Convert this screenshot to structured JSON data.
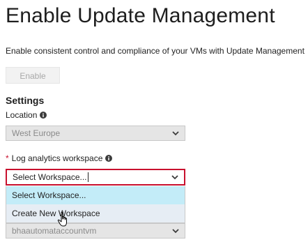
{
  "page": {
    "title": "Enable Update Management",
    "subtitle": "Enable consistent control and compliance of your VMs with Update Management"
  },
  "actions": {
    "enable_label": "Enable"
  },
  "settings": {
    "heading": "Settings",
    "location": {
      "label": "Location",
      "value": "West Europe",
      "icon": "info-icon"
    },
    "workspace": {
      "required_marker": "*",
      "label": "Log analytics workspace",
      "value": "Select Workspace...",
      "icon": "info-icon",
      "options": [
        {
          "label": "Select Workspace...",
          "state": "selected"
        },
        {
          "label": "Create New Workspace",
          "state": "hover"
        }
      ]
    },
    "automation_account": {
      "value": "bhaautomataccountvm"
    }
  },
  "colors": {
    "accent_error": "#c8102e",
    "option_selected": "#c3ecf8",
    "option_hover": "#e6edf4"
  }
}
